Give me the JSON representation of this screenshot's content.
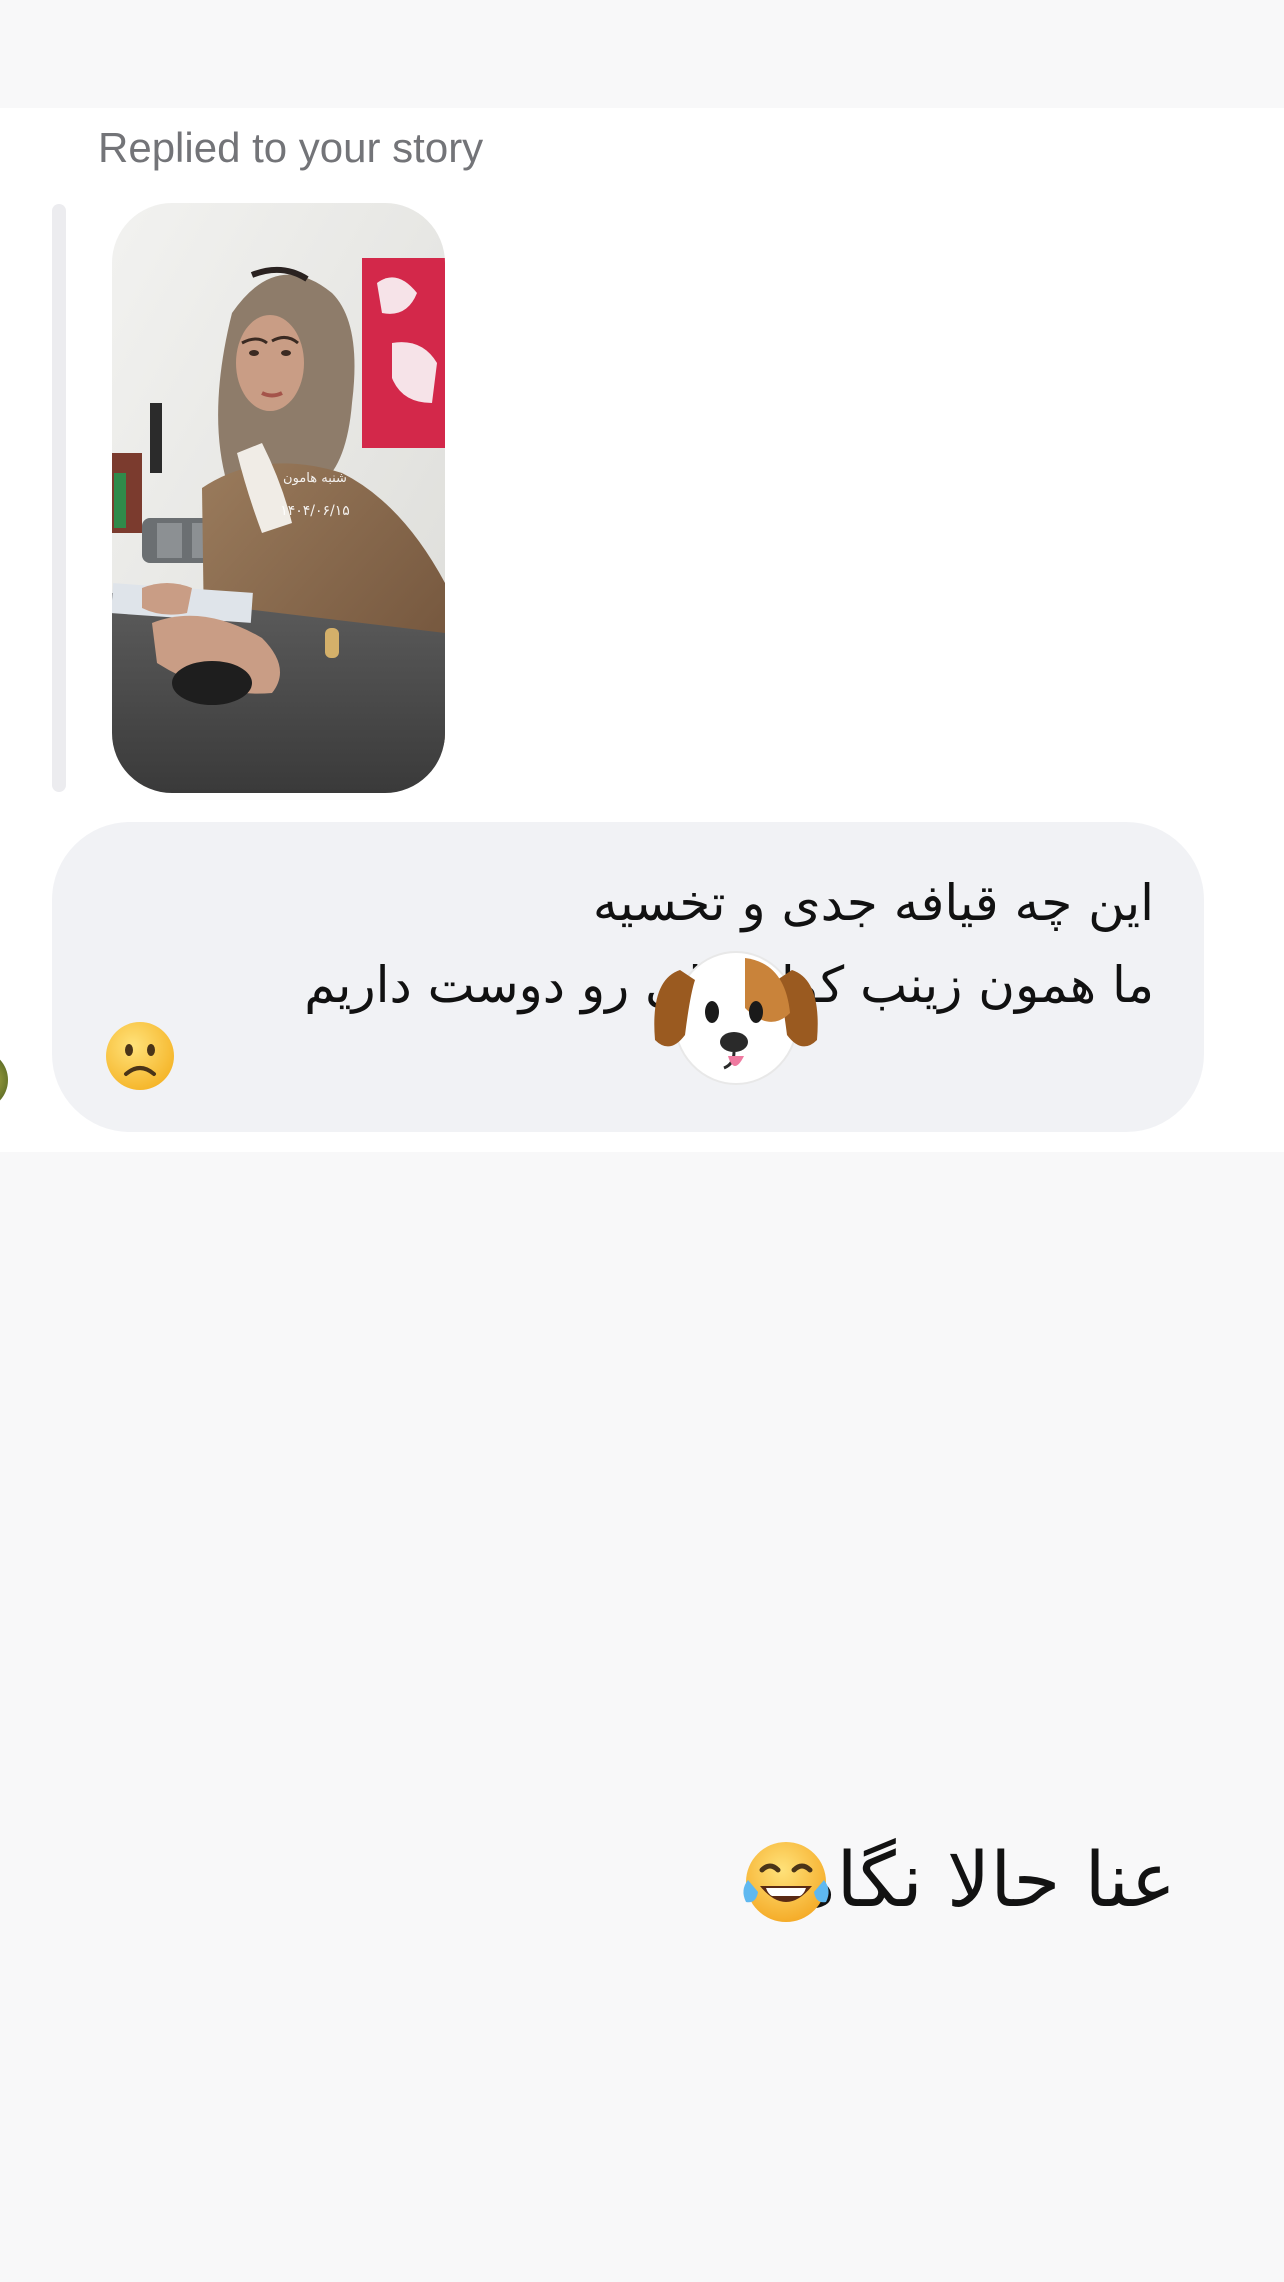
{
  "thread": {
    "reply_context": "Replied to your story",
    "story": {
      "overlay_name": "شنبه هامون",
      "overlay_date": "۱۴۰۴/۰۶/۱۵"
    },
    "received_message": {
      "text": "این چه قیافه جدی و تخسیه\nما همون زینب کول قبلی رو دوست داریم",
      "trailing_emoji": "slightly-frowning-face",
      "sticker": "dog-face-sticker"
    },
    "sent_message": {
      "text": "عنا حالا نگاه",
      "emoji": "face-with-tears-of-joy"
    }
  },
  "colors": {
    "background": "#f8f8f9",
    "panel": "#ffffff",
    "bubble": "#f1f2f5",
    "muted_text": "#737478",
    "reply_bar": "#ececef"
  }
}
